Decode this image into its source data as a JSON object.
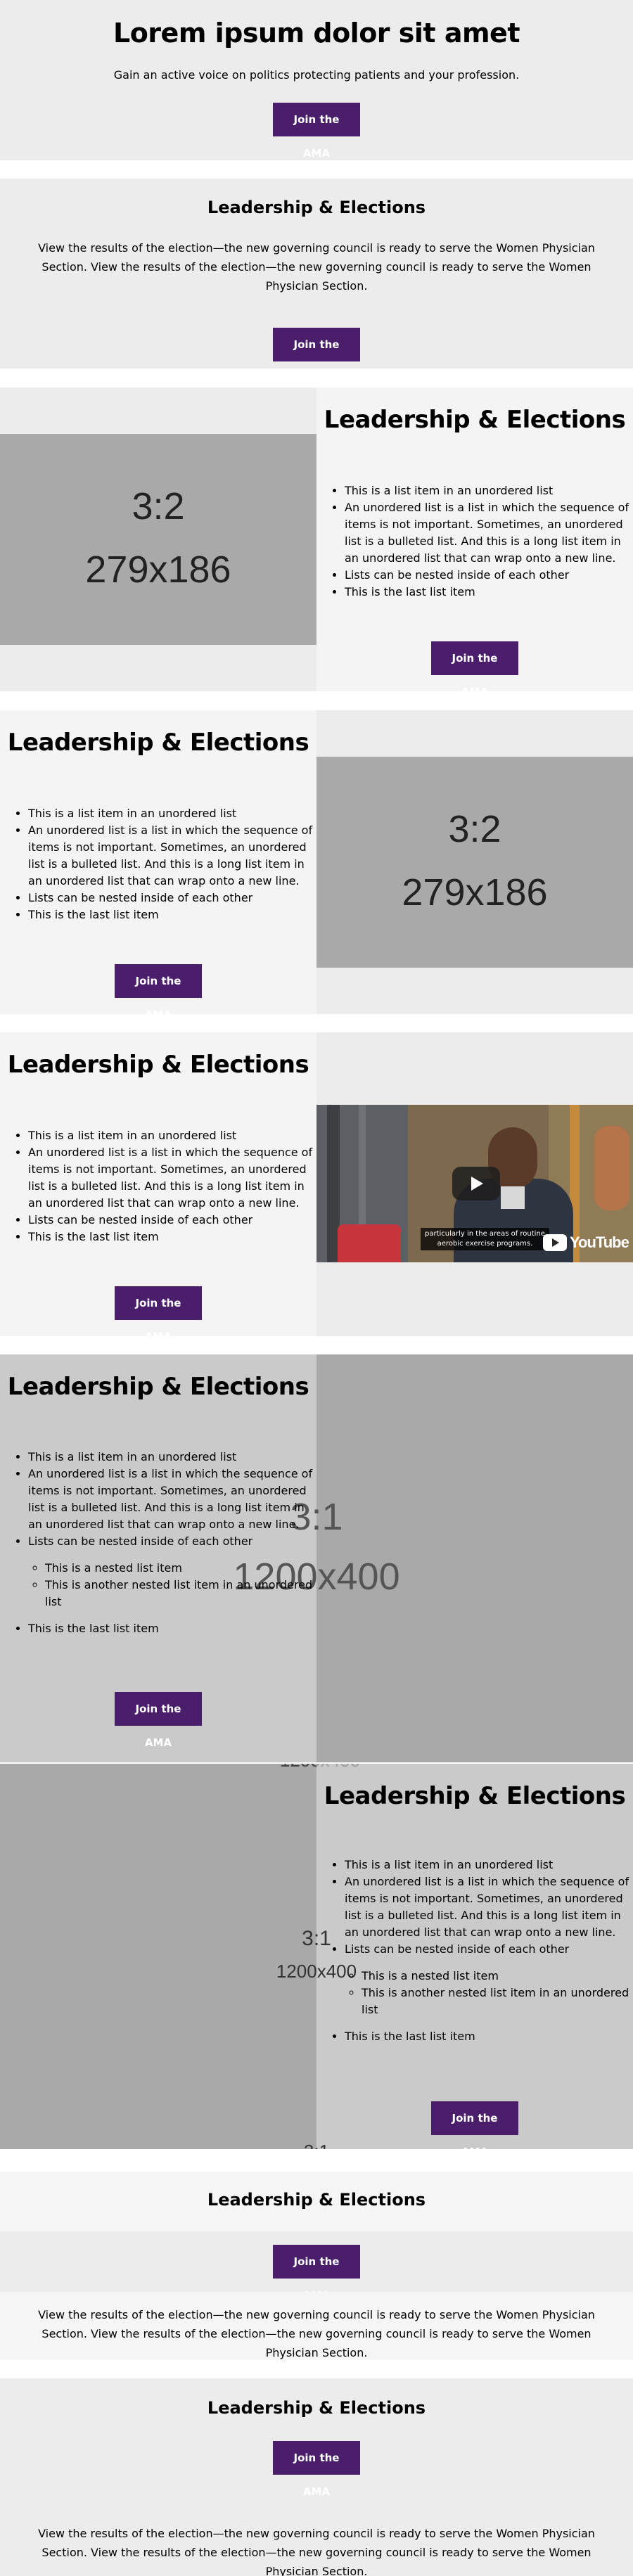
{
  "hero": {
    "title": "Lorem ipsum dolor sit amet",
    "subtitle": "Gain an active voice on politics protecting patients and your profession.",
    "button": "Join the AMA"
  },
  "section2": {
    "title": "Leadership & Elections",
    "body": "View the results of the election—the new governing council is ready to serve the Women Physician Section. View the results of the election—the new governing council is ready to serve the Women Physician Section.",
    "button": "Join the AMA"
  },
  "list_items": [
    "This is a list item in an unordered list",
    "An unordered list is a list in which the sequence of items is not important. Sometimes, an unordered list is a bulleted list. And this is a long list item in an unordered list that can wrap onto a new line.",
    "Lists can be nested inside of each other",
    "This is the last list item"
  ],
  "nested_items": [
    "This is a nested list item",
    "This is another nested list item in an unordered list"
  ],
  "section3": {
    "title": "Leadership & Elections",
    "image_ratio": "3:2",
    "image_size": "279x186",
    "button": "Join the AMA"
  },
  "section4": {
    "title": "Leadership & Elections",
    "image_ratio": "3:2",
    "image_size": "279x186",
    "button": "Join the AMA"
  },
  "section5": {
    "title": "Leadership & Elections",
    "video_caption_line1": "particularly in the areas of routine",
    "video_caption_line2": "aerobic exercise programs.",
    "youtube": "YouTube",
    "button": "Join the AMA"
  },
  "section6": {
    "title": "Leadership & Elections",
    "image_ratio": "3:1",
    "image_size": "1200x400",
    "button": "Join the AMA"
  },
  "section7": {
    "title": "Leadership & Elections",
    "image_ratio": "3:1",
    "image_size": "1200x400",
    "top_label": "1200x400",
    "bottom_label": "3:1",
    "button": "Join the AMA"
  },
  "section8": {
    "title": "Leadership & Elections",
    "button": "Join the AMA",
    "body": "View the results of the election—the new governing council is ready to serve the Women Physician Section. View the results of the election—the new governing council is ready to serve the Women Physician Section."
  },
  "section9": {
    "title": "Leadership & Elections",
    "button": "Join the AMA",
    "body": "View the results of the election—the new governing council is ready to serve the Women Physician Section. View the results of the election—the new governing council is ready to serve the Women Physician Section."
  }
}
